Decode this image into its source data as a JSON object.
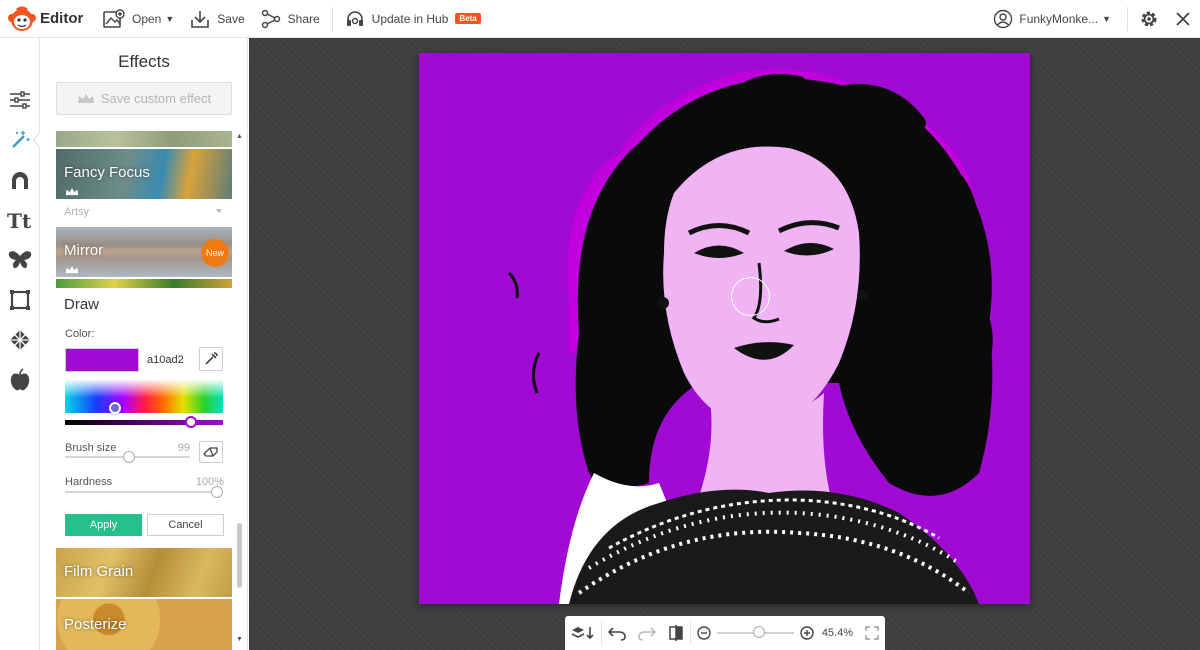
{
  "app": {
    "title": "Editor"
  },
  "toolbar": {
    "open_label": "Open",
    "save_label": "Save",
    "share_label": "Share",
    "hub_label": "Update in Hub",
    "beta_badge": "Beta"
  },
  "user": {
    "name": "FunkyMonke..."
  },
  "rail": {
    "items": [
      "adjustments-icon",
      "effects-wand-icon",
      "touch-up-icon",
      "text-icon",
      "graphics-butterfly-icon",
      "frames-icon",
      "textures-icon",
      "themes-apple-icon"
    ]
  },
  "effects": {
    "title": "Effects",
    "save_custom_label": "Save custom effect",
    "thumbs": [
      {
        "label": "Fancy Focus"
      },
      {
        "label": "Mirror",
        "badge": "New"
      },
      {
        "label": "Film Grain"
      },
      {
        "label": "Posterize"
      }
    ],
    "section_label": "Artsy"
  },
  "draw": {
    "title": "Draw",
    "color_label": "Color:",
    "hex_value": "a10ad2",
    "swatch_color": "#a10ad2",
    "brush_size_label": "Brush size",
    "brush_size_value": "99",
    "hardness_label": "Hardness",
    "hardness_value": "100%",
    "apply_label": "Apply",
    "cancel_label": "Cancel"
  },
  "canvas": {
    "background_color": "#a10ad2"
  },
  "zoom": {
    "level": "45.4%"
  }
}
